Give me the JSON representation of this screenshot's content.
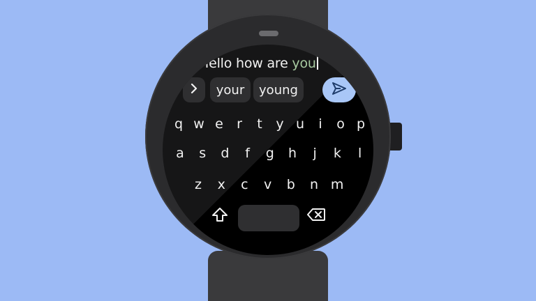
{
  "input": {
    "typed": "Hello how are ",
    "completion": "you"
  },
  "suggestions": [
    "your",
    "young"
  ],
  "expand_symbol": "›",
  "keyboard": {
    "row1": [
      "q",
      "w",
      "e",
      "r",
      "t",
      "y",
      "u",
      "i",
      "o",
      "p"
    ],
    "row2": [
      "a",
      "s",
      "d",
      "f",
      "g",
      "h",
      "j",
      "k",
      "l"
    ],
    "row3": [
      "z",
      "x",
      "c",
      "v",
      "b",
      "n",
      "m"
    ]
  },
  "icons": {
    "send": "send-icon",
    "shift": "shift-icon",
    "backspace": "backspace-icon",
    "expand": "chevron-right-icon"
  },
  "colors": {
    "background": "#9cbaf5",
    "send_button": "#a9c7f7",
    "completion_text": "#a7c9a0"
  }
}
